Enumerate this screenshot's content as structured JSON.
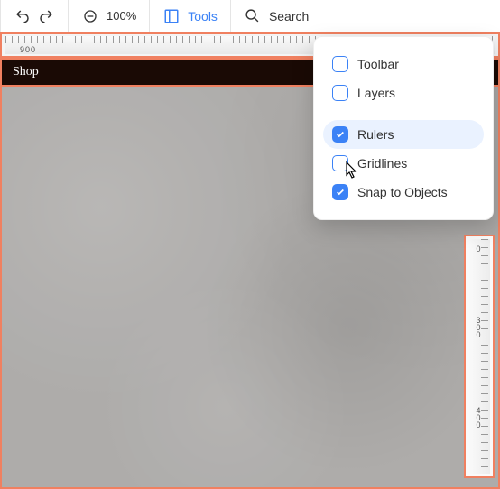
{
  "toolbar": {
    "zoom_label": "100%",
    "tools_label": "Tools",
    "search_label": "Search"
  },
  "h_ruler": {
    "label": "900"
  },
  "nav": {
    "item1": "Shop"
  },
  "v_ruler": {
    "l0": "0",
    "l300": "300",
    "l400": "400"
  },
  "dropdown": {
    "toolbar": "Toolbar",
    "layers": "Layers",
    "rulers": "Rulers",
    "gridlines": "Gridlines",
    "snap": "Snap to Objects"
  }
}
